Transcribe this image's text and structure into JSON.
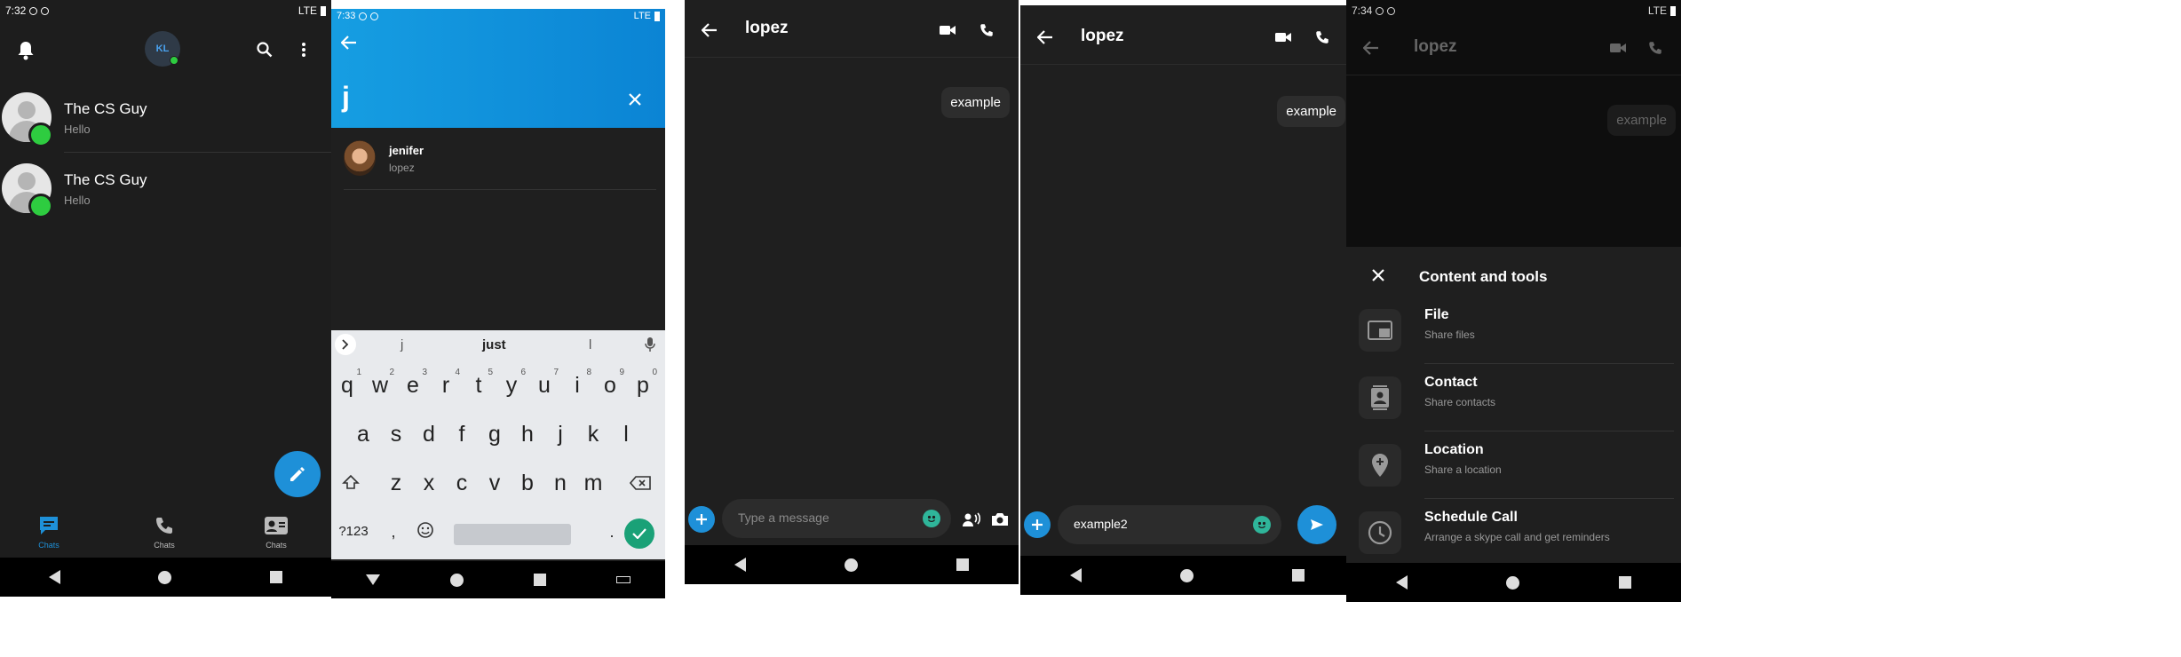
{
  "s1": {
    "status_time": "7:32",
    "status_net": "LTE",
    "avatar_initials": "KL",
    "chats": [
      {
        "name": "The CS Guy",
        "message": "Hello"
      },
      {
        "name": "The CS Guy",
        "message": "Hello"
      }
    ],
    "tabs": [
      "Chats",
      "Chats",
      "Chats"
    ],
    "accent": "#1e90d8"
  },
  "s2": {
    "status_time": "7:33",
    "status_net": "LTE",
    "search_text": "j",
    "result_name": "jenifer",
    "result_subtitle": "lopez",
    "suggestions": [
      "j",
      "just",
      "l"
    ],
    "keyboard_rows": [
      [
        "q",
        "w",
        "e",
        "r",
        "t",
        "y",
        "u",
        "i",
        "o",
        "p"
      ],
      [
        "a",
        "s",
        "d",
        "f",
        "g",
        "h",
        "j",
        "k",
        "l"
      ],
      [
        "z",
        "x",
        "c",
        "v",
        "b",
        "n",
        "m"
      ]
    ],
    "number_hints": [
      "1",
      "2",
      "3",
      "4",
      "5",
      "6",
      "7",
      "8",
      "9",
      "0"
    ],
    "key_symbols": "?123",
    "key_comma": ",",
    "key_period": ".",
    "header_gradient": [
      "#1e9be0",
      "#0d7fd0"
    ]
  },
  "s3": {
    "title": "lopez",
    "message": "example",
    "placeholder": "Type a message"
  },
  "s4": {
    "title": "lopez",
    "message": "example",
    "input_value": "example2"
  },
  "s5": {
    "status_time": "7:34",
    "status_net": "LTE",
    "title": "lopez",
    "message": "example",
    "sheet_title": "Content and tools",
    "items": [
      {
        "title": "File",
        "subtitle": "Share files",
        "icon": "file-icon"
      },
      {
        "title": "Contact",
        "subtitle": "Share contacts",
        "icon": "contact-icon"
      },
      {
        "title": "Location",
        "subtitle": "Share a location",
        "icon": "location-icon"
      },
      {
        "title": "Schedule Call",
        "subtitle": "Arrange a skype call and get reminders",
        "icon": "clock-icon"
      }
    ]
  }
}
